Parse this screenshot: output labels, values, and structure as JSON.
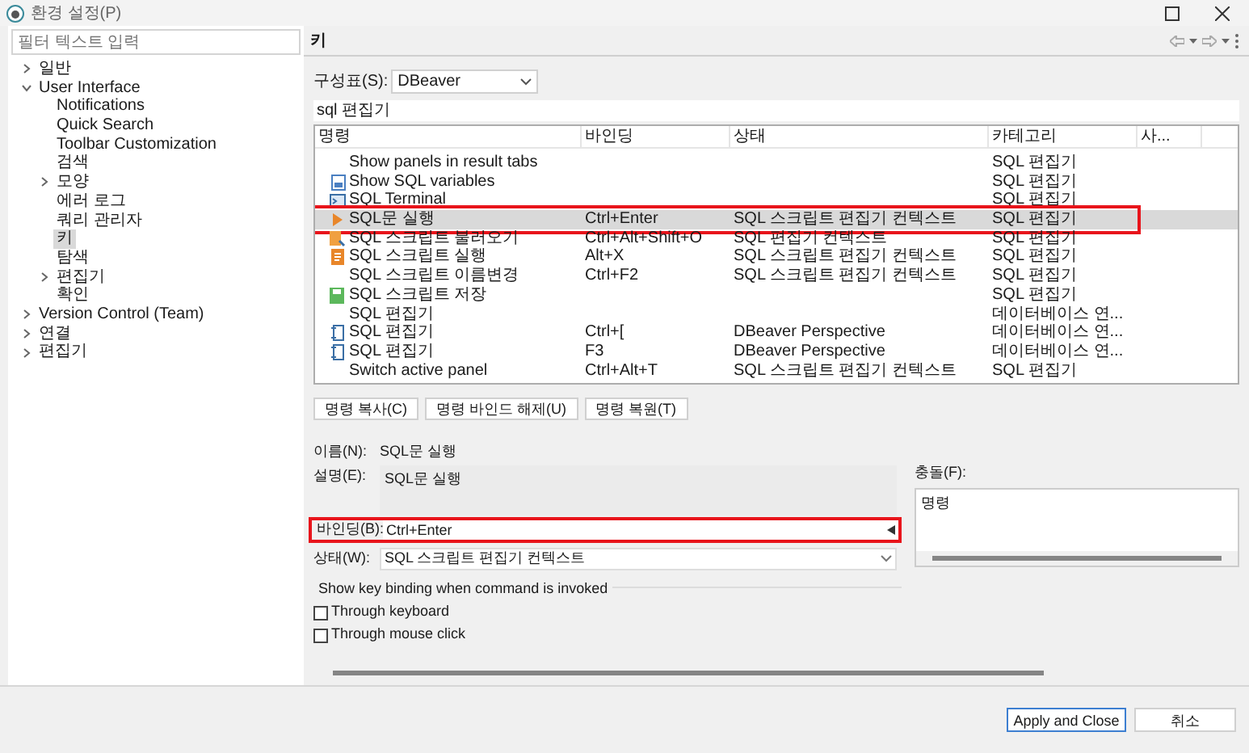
{
  "window": {
    "title": "환경 설정(P)"
  },
  "sidebar": {
    "filter_placeholder": "필터 텍스트 입력",
    "items": [
      {
        "label": "일반",
        "expanded": false,
        "selected": false
      },
      {
        "label": "User Interface",
        "expanded": true,
        "selected": false,
        "children": [
          {
            "label": "Notifications",
            "selected": false
          },
          {
            "label": "Quick Search",
            "selected": false
          },
          {
            "label": "Toolbar Customization",
            "selected": false
          },
          {
            "label": "검색",
            "selected": false
          },
          {
            "label": "모양",
            "expanded": false,
            "selected": false
          },
          {
            "label": "에러 로그",
            "selected": false
          },
          {
            "label": "쿼리 관리자",
            "selected": false
          },
          {
            "label": "키",
            "selected": true
          },
          {
            "label": "탐색",
            "selected": false
          },
          {
            "label": "편집기",
            "expanded": false,
            "selected": false
          },
          {
            "label": "확인",
            "selected": false
          }
        ]
      },
      {
        "label": "Version Control (Team)",
        "expanded": false,
        "selected": false
      },
      {
        "label": "연결",
        "expanded": false,
        "selected": false
      },
      {
        "label": "편집기",
        "expanded": false,
        "selected": false
      }
    ]
  },
  "page": {
    "title": "키",
    "scheme_label": "구성표(S):",
    "scheme_value": "DBeaver",
    "filter_value": "sql 편집기",
    "table": {
      "columns": [
        "명령",
        "바인딩",
        "상태",
        "카테고리",
        "사..."
      ],
      "rows": [
        {
          "kind": "none",
          "command": "Show panels in result tabs",
          "binding": "",
          "when": "",
          "category": "SQL 편집기",
          "selected": false,
          "highlighted": false
        },
        {
          "kind": "doc",
          "command": "Show SQL variables",
          "binding": "",
          "when": "",
          "category": "SQL 편집기",
          "selected": false,
          "highlighted": false
        },
        {
          "kind": "terminal",
          "command": "SQL Terminal",
          "binding": "",
          "when": "",
          "category": "SQL 편집기",
          "selected": false,
          "highlighted": false
        },
        {
          "kind": "run",
          "command": "SQL문 실행",
          "binding": "Ctrl+Enter",
          "when": "SQL 스크립트 편집기 컨텍스트",
          "category": "SQL 편집기",
          "selected": true,
          "highlighted": true
        },
        {
          "kind": "open",
          "command": "SQL 스크립트 불러오기",
          "binding": "Ctrl+Alt+Shift+O",
          "when": "SQL 편집기 컨텍스트",
          "category": "SQL 편집기",
          "selected": false,
          "highlighted": false
        },
        {
          "kind": "script",
          "command": "SQL 스크립트 실행",
          "binding": "Alt+X",
          "when": "SQL 스크립트 편집기 컨텍스트",
          "category": "SQL 편집기",
          "selected": false,
          "highlighted": false
        },
        {
          "kind": "none",
          "command": "SQL 스크립트 이름변경",
          "binding": "Ctrl+F2",
          "when": "SQL 스크립트 편집기 컨텍스트",
          "category": "SQL 편집기",
          "selected": false,
          "highlighted": false
        },
        {
          "kind": "save",
          "command": "SQL 스크립트 저장",
          "binding": "",
          "when": "",
          "category": "SQL 편집기",
          "selected": false,
          "highlighted": false
        },
        {
          "kind": "none",
          "command": "SQL 편집기",
          "binding": "",
          "when": "",
          "category": "데이터베이스 연...",
          "selected": false,
          "highlighted": false
        },
        {
          "kind": "editor",
          "command": "SQL 편집기",
          "binding": "Ctrl+[",
          "when": "DBeaver Perspective",
          "category": "데이터베이스 연...",
          "selected": false,
          "highlighted": false
        },
        {
          "kind": "editor",
          "command": "SQL 편집기",
          "binding": "F3",
          "when": "DBeaver Perspective",
          "category": "데이터베이스 연...",
          "selected": false,
          "highlighted": false
        },
        {
          "kind": "none",
          "command": "Switch active panel",
          "binding": "Ctrl+Alt+T",
          "when": "SQL 스크립트 편집기 컨텍스트",
          "category": "SQL 편집기",
          "selected": false,
          "highlighted": false
        }
      ]
    },
    "buttons": [
      "명령 복사(C)",
      "명령 바인드 해제(U)",
      "명령 복원(T)"
    ],
    "name_label": "이름(N):",
    "name_value": "SQL문 실행",
    "description_label": "설명(E):",
    "description_value": "SQL문 실행",
    "binding_label": "바인딩(B):",
    "binding_value": "Ctrl+Enter",
    "binding_highlighted": true,
    "when_label": "상태(W):",
    "when_value": "SQL 스크립트 편집기 컨텍스트",
    "conflicts_label": "충돌(F):",
    "conflicts_header": "명령",
    "show_binding": {
      "title": "Show key binding when command is invoked",
      "options": [
        {
          "label": "Through keyboard",
          "checked": false
        },
        {
          "label": "Through mouse click",
          "checked": false
        }
      ]
    }
  },
  "footer": {
    "buttons": [
      "Apply and Close",
      "취소"
    ]
  }
}
